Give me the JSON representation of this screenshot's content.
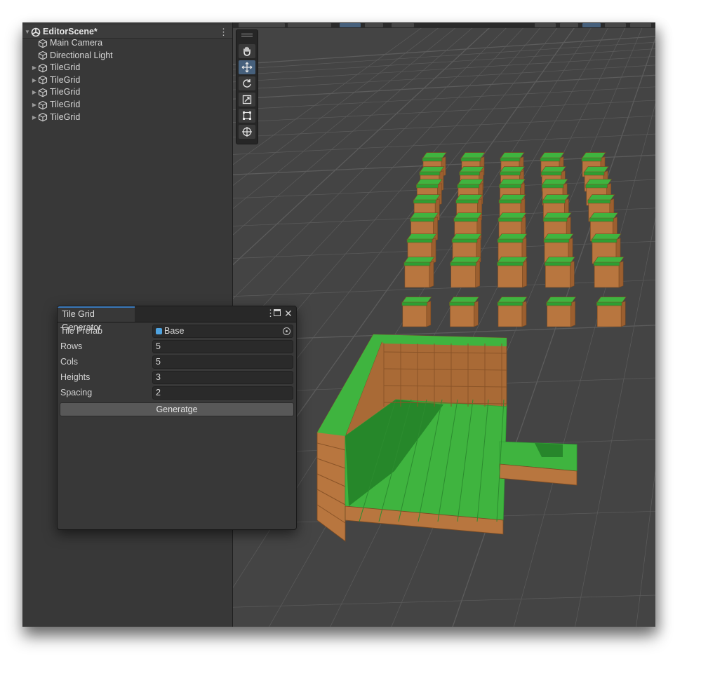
{
  "hierarchy": {
    "scene_name": "EditorScene*",
    "items": [
      {
        "label": "Main Camera",
        "expandable": false
      },
      {
        "label": "Directional Light",
        "expandable": false
      },
      {
        "label": "TileGrid",
        "expandable": true
      },
      {
        "label": "TileGrid",
        "expandable": true
      },
      {
        "label": "TileGrid",
        "expandable": true
      },
      {
        "label": "TileGrid",
        "expandable": true
      },
      {
        "label": "TileGrid",
        "expandable": true
      }
    ]
  },
  "scene_view": {
    "tools": [
      "hand-tool",
      "move-tool",
      "rotate-tool",
      "scale-tool",
      "rect-tool",
      "transform-tool"
    ],
    "active_tool": "move-tool",
    "colors": {
      "grass": "#3fb43f",
      "dirt": "#b8763f",
      "background": "#454545"
    }
  },
  "tile_grid_generator": {
    "title": "Tile Grid Generator",
    "fields": {
      "tile_prefab": {
        "label": "Tile Prefab",
        "value": "Base"
      },
      "rows": {
        "label": "Rows",
        "value": "5"
      },
      "cols": {
        "label": "Cols",
        "value": "5"
      },
      "heights": {
        "label": "Heights",
        "value": "3"
      },
      "spacing": {
        "label": "Spacing",
        "value": "2"
      }
    },
    "generate_label": "Generatge"
  }
}
